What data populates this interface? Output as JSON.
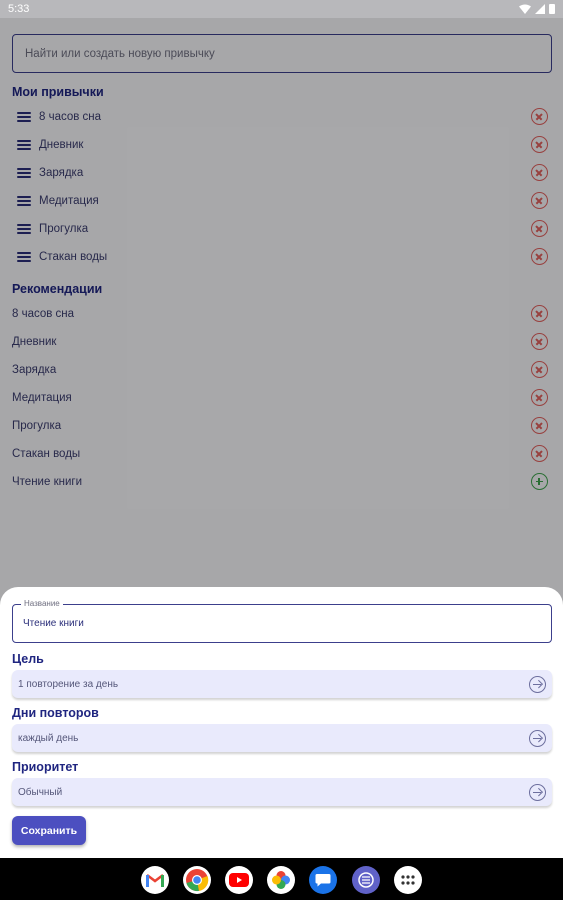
{
  "status_bar": {
    "time": "5:33"
  },
  "search": {
    "placeholder": "Найти или создать новую привычку"
  },
  "my_habits": {
    "title": "Мои привычки",
    "items": [
      "8 часов сна",
      "Дневник",
      "Зарядка",
      "Медитация",
      "Прогулка",
      "Стакан воды"
    ]
  },
  "recommendations": {
    "title": "Рекомендации",
    "items": [
      "8 часов сна",
      "Дневник",
      "Зарядка",
      "Медитация",
      "Прогулка",
      "Стакан воды",
      "Чтение книги"
    ]
  },
  "sheet": {
    "name_label": "Название",
    "name_value": "Чтение книги",
    "goal_label": "Цель",
    "goal_value": "1 повторение за день",
    "days_label": "Дни повторов",
    "days_value": "каждый день",
    "priority_label": "Приоритет",
    "priority_value": "Обычный",
    "save_label": "Сохранить"
  },
  "colors": {
    "accent": "#4c4fc0",
    "title": "#1f2580",
    "remove": "#e0605e",
    "add": "#3fa34d"
  },
  "dock_apps": [
    "gmail-icon",
    "chrome-icon",
    "youtube-icon",
    "photos-icon",
    "messages-icon",
    "app-icon",
    "apps-grid-icon"
  ]
}
